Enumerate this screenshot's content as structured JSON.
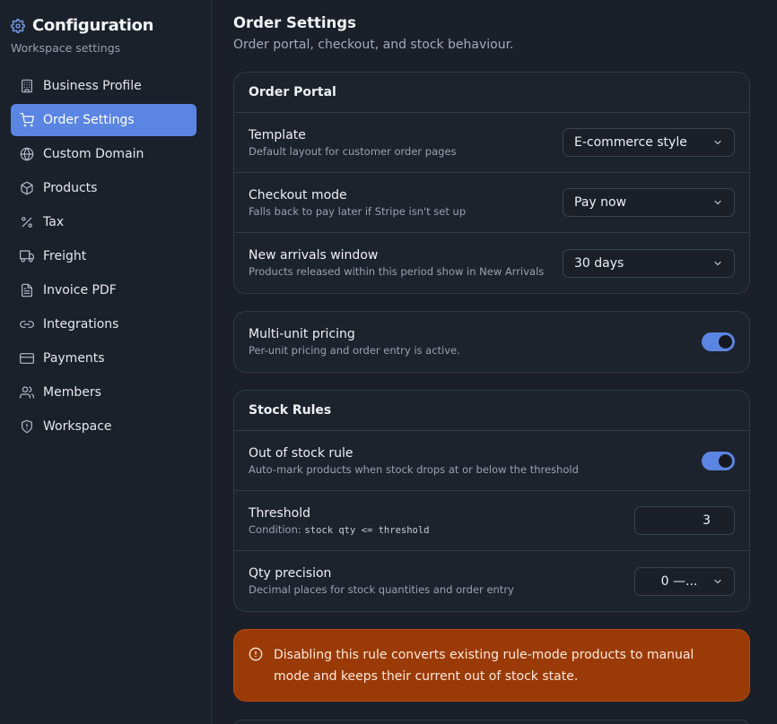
{
  "sidebar": {
    "title": "Configuration",
    "subtitle": "Workspace settings",
    "items": [
      {
        "label": "Business Profile",
        "icon": "building-icon"
      },
      {
        "label": "Order Settings",
        "icon": "cart-icon",
        "active": true
      },
      {
        "label": "Custom Domain",
        "icon": "globe-icon"
      },
      {
        "label": "Products",
        "icon": "box-icon"
      },
      {
        "label": "Tax",
        "icon": "percent-icon"
      },
      {
        "label": "Freight",
        "icon": "truck-icon"
      },
      {
        "label": "Invoice PDF",
        "icon": "file-icon"
      },
      {
        "label": "Integrations",
        "icon": "link-icon"
      },
      {
        "label": "Payments",
        "icon": "credit-card-icon"
      },
      {
        "label": "Members",
        "icon": "users-icon"
      },
      {
        "label": "Workspace",
        "icon": "shield-icon"
      }
    ]
  },
  "main": {
    "title": "Order Settings",
    "subtitle": "Order portal, checkout, and stock behaviour.",
    "order_portal": {
      "heading": "Order Portal",
      "template": {
        "label": "Template",
        "desc": "Default layout for customer order pages",
        "value": "E-commerce style"
      },
      "checkout": {
        "label": "Checkout mode",
        "desc": "Falls back to pay later if Stripe isn't set up",
        "value": "Pay now"
      },
      "arrivals": {
        "label": "New arrivals window",
        "desc": "Products released within this period show in New Arrivals",
        "value": "30 days"
      }
    },
    "multi_unit": {
      "label": "Multi-unit pricing",
      "desc": "Per-unit pricing and order entry is active.",
      "enabled": true
    },
    "stock_rules": {
      "heading": "Stock Rules",
      "out_of_stock": {
        "label": "Out of stock rule",
        "desc": "Auto-mark products when stock drops at or below the threshold",
        "enabled": true
      },
      "threshold": {
        "label": "Threshold",
        "desc_prefix": "Condition: ",
        "desc_code": "stock qty <= threshold",
        "value": "3"
      },
      "precision": {
        "label": "Qty precision",
        "desc": "Decimal places for stock quantities and order entry",
        "value": "0 —..."
      }
    },
    "alert": {
      "text": "Disabling this rule converts existing rule-mode products to manual mode and keeps their current out of stock state."
    }
  },
  "colors": {
    "accent": "#5b85e3",
    "warning": "#9a3a06",
    "background": "#1a1f29"
  }
}
